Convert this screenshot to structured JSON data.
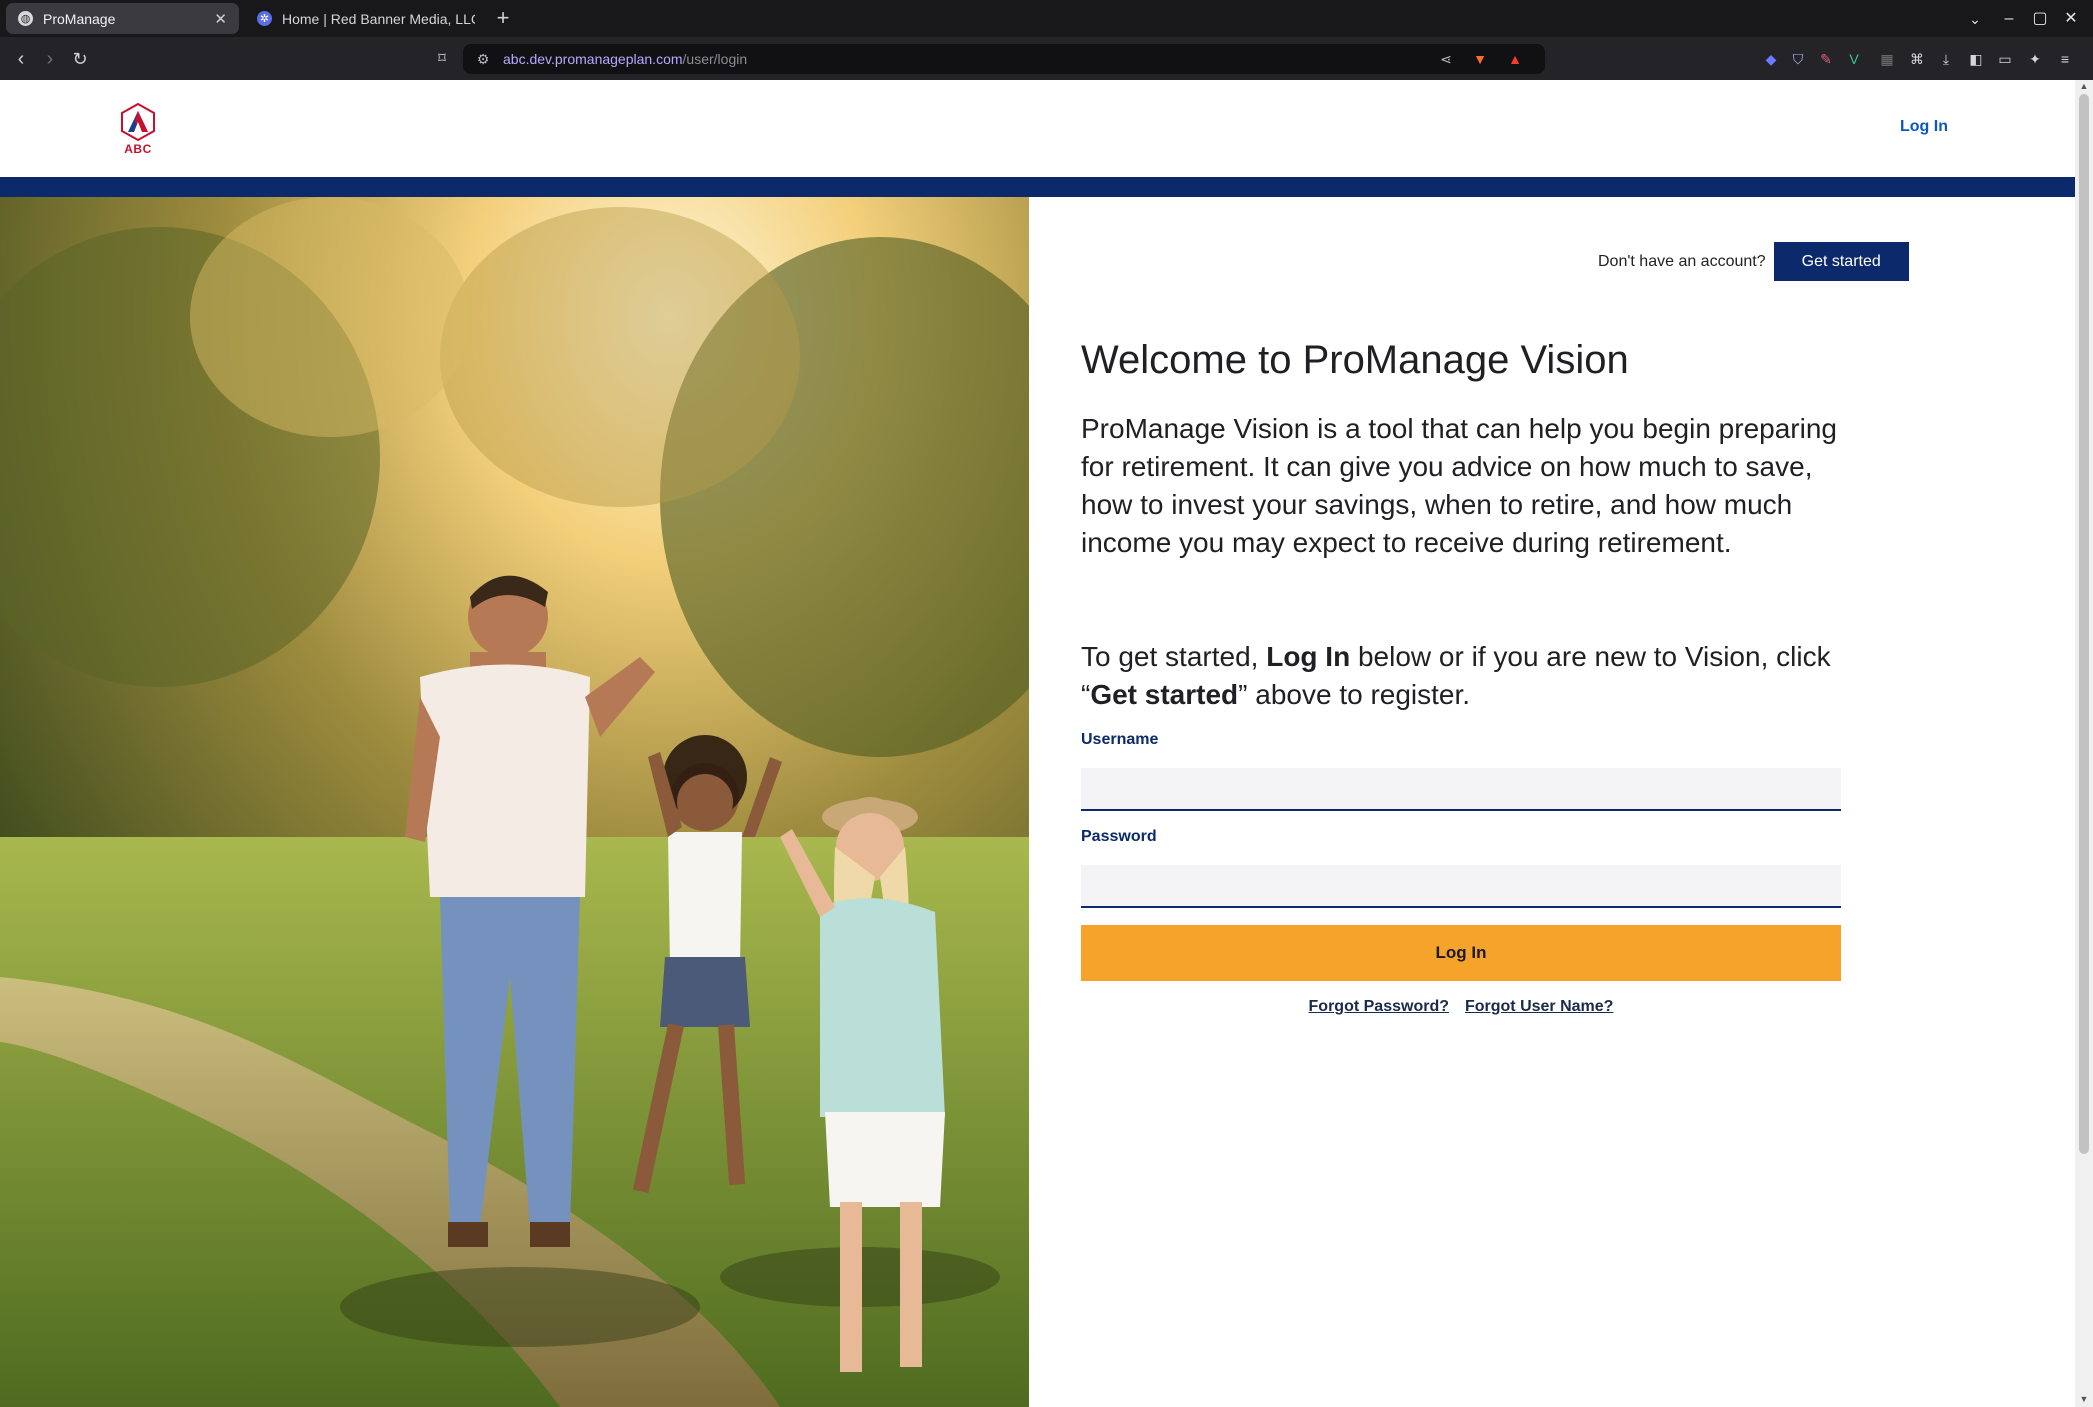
{
  "browser": {
    "tabs": [
      {
        "title": "ProManage",
        "active": true
      },
      {
        "title": "Home | Red Banner Media, LLC ·",
        "active": false
      }
    ],
    "url_host": "abc.dev.promanageplan.com",
    "url_path": "/user/login"
  },
  "header": {
    "logo_text": "ABC",
    "login_link": "Log In"
  },
  "signup": {
    "prompt": "Don't have an account?",
    "button": "Get started"
  },
  "main": {
    "title": "Welcome to ProManage Vision",
    "intro": "ProManage Vision is a tool that can help you begin preparing for retirement. It can give you advice on how much to save, how to invest your savings, when to retire, and how much income you may expect to receive during retirement.",
    "start_prefix": "To get started, ",
    "start_bold1": "Log In",
    "start_middle": " below or if you are new to Vision, click “",
    "start_bold2": "Get started",
    "start_suffix": "” above to register."
  },
  "form": {
    "username_label": "Username",
    "username_value": "",
    "password_label": "Password",
    "password_value": "",
    "submit": "Log In",
    "forgot_password": "Forgot Password?",
    "forgot_username": "Forgot User Name?"
  },
  "colors": {
    "navy": "#0c2a6b",
    "accent": "#f6a32b",
    "link": "#0b57c8",
    "logo_red": "#c8102e"
  }
}
